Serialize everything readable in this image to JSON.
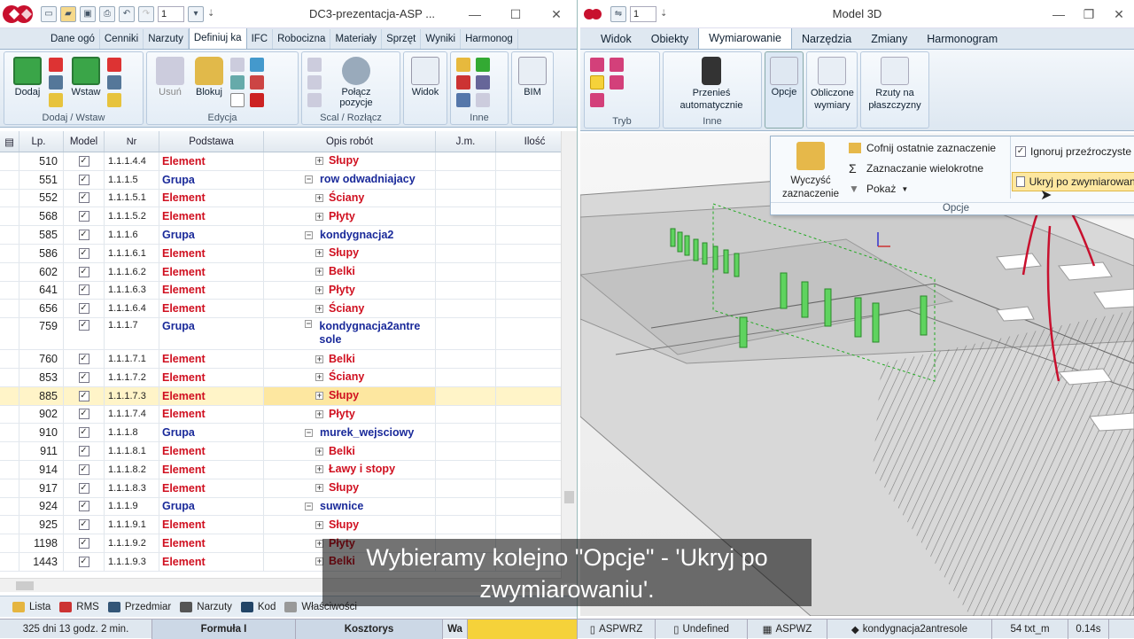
{
  "left_window": {
    "title": "DC3-prezentacja-ASP ...",
    "qat_value": "1",
    "tabs": [
      "Dane ogó",
      "Cenniki",
      "Narzuty",
      "Definiuj ka",
      "IFC",
      "Robocizna",
      "Materiały",
      "Sprzęt",
      "Wyniki",
      "Harmonog"
    ],
    "active_tab": "Definiuj ka",
    "ribbon": {
      "group_add": {
        "label": "Dodaj / Wstaw",
        "add": "Dodaj",
        "insert": "Wstaw"
      },
      "group_edit": {
        "label": "Edycja",
        "delete": "Usuń",
        "lock": "Blokuj"
      },
      "group_merge": {
        "label": "Scal / Rozłącz",
        "connect": "Połącz\npozycje"
      },
      "group_view": {
        "label": "",
        "view": "Widok"
      },
      "group_other": {
        "label": "Inne"
      },
      "group_bim": {
        "label": "",
        "bim": "BIM"
      }
    },
    "grid": {
      "headers": [
        "Lp.",
        "Model",
        "Nr",
        "Podstawa",
        "Opis robót",
        "J.m.",
        "Ilość"
      ],
      "rows": [
        {
          "lp": "510",
          "nr": "1.1.1.4.4",
          "base": "Element",
          "desc": "Słupy",
          "type": "el",
          "indent": 2
        },
        {
          "lp": "551",
          "nr": "1.1.1.5",
          "base": "Grupa",
          "desc": "row odwadniajacy",
          "type": "gr",
          "indent": 1
        },
        {
          "lp": "552",
          "nr": "1.1.1.5.1",
          "base": "Element",
          "desc": "Ściany",
          "type": "el",
          "indent": 2
        },
        {
          "lp": "568",
          "nr": "1.1.1.5.2",
          "base": "Element",
          "desc": "Płyty",
          "type": "el",
          "indent": 2
        },
        {
          "lp": "585",
          "nr": "1.1.1.6",
          "base": "Grupa",
          "desc": "kondygnacja2",
          "type": "gr",
          "indent": 1
        },
        {
          "lp": "586",
          "nr": "1.1.1.6.1",
          "base": "Element",
          "desc": "Słupy",
          "type": "el",
          "indent": 2
        },
        {
          "lp": "602",
          "nr": "1.1.1.6.2",
          "base": "Element",
          "desc": "Belki",
          "type": "el",
          "indent": 2
        },
        {
          "lp": "641",
          "nr": "1.1.1.6.3",
          "base": "Element",
          "desc": "Płyty",
          "type": "el",
          "indent": 2
        },
        {
          "lp": "656",
          "nr": "1.1.1.6.4",
          "base": "Element",
          "desc": "Ściany",
          "type": "el",
          "indent": 2
        },
        {
          "lp": "759",
          "nr": "1.1.1.7",
          "base": "Grupa",
          "desc": "kondygnacja2antre sole",
          "type": "gr",
          "indent": 1,
          "tall": true
        },
        {
          "lp": "760",
          "nr": "1.1.1.7.1",
          "base": "Element",
          "desc": "Belki",
          "type": "el",
          "indent": 2
        },
        {
          "lp": "853",
          "nr": "1.1.1.7.2",
          "base": "Element",
          "desc": "Ściany",
          "type": "el",
          "indent": 2
        },
        {
          "lp": "885",
          "nr": "1.1.1.7.3",
          "base": "Element",
          "desc": "Słupy",
          "type": "el",
          "indent": 2,
          "selected": true
        },
        {
          "lp": "902",
          "nr": "1.1.1.7.4",
          "base": "Element",
          "desc": "Płyty",
          "type": "el",
          "indent": 2
        },
        {
          "lp": "910",
          "nr": "1.1.1.8",
          "base": "Grupa",
          "desc": "murek_wejsciowy",
          "type": "gr",
          "indent": 1
        },
        {
          "lp": "911",
          "nr": "1.1.1.8.1",
          "base": "Element",
          "desc": "Belki",
          "type": "el",
          "indent": 2
        },
        {
          "lp": "914",
          "nr": "1.1.1.8.2",
          "base": "Element",
          "desc": "Ławy i stopy",
          "type": "el",
          "indent": 2
        },
        {
          "lp": "917",
          "nr": "1.1.1.8.3",
          "base": "Element",
          "desc": "Słupy",
          "type": "el",
          "indent": 2
        },
        {
          "lp": "924",
          "nr": "1.1.1.9",
          "base": "Grupa",
          "desc": "suwnice",
          "type": "gr",
          "indent": 1
        },
        {
          "lp": "925",
          "nr": "1.1.1.9.1",
          "base": "Element",
          "desc": "Słupy",
          "type": "el",
          "indent": 2
        },
        {
          "lp": "1198",
          "nr": "1.1.1.9.2",
          "base": "Element",
          "desc": "Płyty",
          "type": "el",
          "indent": 2
        },
        {
          "lp": "1443",
          "nr": "1.1.1.9.3",
          "base": "Element",
          "desc": "Belki",
          "type": "el",
          "indent": 2
        }
      ]
    },
    "bottom_tabs": [
      "Lista",
      "RMS",
      "Przedmiar",
      "Narzuty",
      "Kod",
      "Właściwości"
    ]
  },
  "right_window": {
    "title": "Model 3D",
    "qat_value": "1",
    "tabs": [
      "Widok",
      "Obiekty",
      "Wymiarowanie",
      "Narzędzia",
      "Zmiany",
      "Harmonogram"
    ],
    "active_tab": "Wymiarowanie",
    "ribbon": {
      "group_mode": {
        "label": "Tryb"
      },
      "group_other": {
        "label": "Inne",
        "move_auto": "Przenieś\nautomatycznie"
      },
      "options": "Opcje",
      "computed_dims": "Obliczone\nwymiary",
      "plane_proj": "Rzuty na\npłaszczyzny"
    },
    "popup": {
      "clear": "Wyczyść\nzaznaczenie",
      "undo_sel": "Cofnij ostatnie zaznaczenie",
      "multi_sel": "Zaznaczanie wielokrotne",
      "show": "Pokaż",
      "ignore_transp": "Ignoruj przeźroczyste",
      "hide_after": "Ukryj po zwymiarowaniu",
      "group_label": "Opcje"
    }
  },
  "status_bar": {
    "time": "325 dni 13 godz. 2 min.",
    "formula": "Formuła I",
    "costs": "Kosztorys",
    "wa": "Wa",
    "aspwrz": "ASPWRZ",
    "undefined": "Undefined",
    "aspwz": "ASPWZ",
    "floor": "kondygnacja2antresole",
    "txt": "54 txt_m",
    "secs": "0.14s"
  },
  "subtitle": "Wybieramy kolejno \"Opcje\" - 'Ukryj po zwymiarowaniu'.",
  "colors": {
    "element": "#d01020",
    "group": "#1a2a9a",
    "selected_row": "#fff4c8",
    "highlight": "#f5d23a"
  }
}
